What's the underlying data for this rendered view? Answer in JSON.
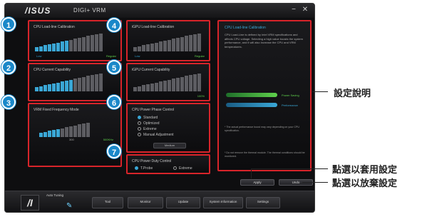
{
  "window": {
    "brand": "/ISUS",
    "title": "DIGI+ VRM",
    "minimize_glyph": "−",
    "close_glyph": "✕"
  },
  "panels": {
    "cpu_llc": {
      "title": "CPU Load-line Calibration",
      "low": "Low",
      "high": "Regular",
      "level": 8,
      "total": 16
    },
    "igpu_llc": {
      "title": "iGPU Load-line Calibration",
      "low": "Low",
      "high": "Regular",
      "level": 0,
      "total": 16
    },
    "cpu_current": {
      "title": "CPU Current Capability",
      "high": "100%",
      "level": 9,
      "total": 16
    },
    "igpu_current": {
      "title": "iGPU Current Capability",
      "high": "100%",
      "level": 0,
      "total": 16
    },
    "vrm_freq": {
      "title": "VRM Fixed Frequency Mode",
      "mid": "300",
      "high": "500KHz",
      "level": 5,
      "total": 12
    },
    "power_phase": {
      "title": "CPU Power Phase Control",
      "options": [
        "Standard",
        "Optimized",
        "Extreme",
        "Manual Adjustment"
      ],
      "selected": 0,
      "button": "Medium"
    },
    "power_duty": {
      "title": "CPU Power Duty Control",
      "options": [
        "T.Probe",
        "Extreme"
      ],
      "selected": 0
    }
  },
  "info": {
    "title": "CPU Load-line Calibration",
    "text": "CPU Load-Line is defined by Intel VRM specifications and affects CPU voltage. Selecting a high value boosts the system performance, and it will also increase the CPU and VRM temperatures.",
    "legend_1": "Power Saving",
    "legend_2": "Performance",
    "note_1": "* The actual performance boost may vary depending on your CPU specification.",
    "note_2": "* Do not remove the thermal module. The thermal conditions should be monitored."
  },
  "actions": {
    "apply": "Apply",
    "undo": "Undo"
  },
  "bottom": {
    "auto_tuning": "Auto Tuning",
    "tabs": [
      "Tool",
      "Monitor",
      "Update",
      "System Information",
      "Settings"
    ]
  },
  "badges": [
    "1",
    "2",
    "3",
    "4",
    "5",
    "6",
    "7"
  ],
  "callouts": {
    "description": "設定說明",
    "apply": "點選以套用設定",
    "undo": "點選以放棄設定"
  },
  "colors": {
    "accent": "#3aa7d6",
    "highlight": "#d8242a",
    "badge": "#1a88c9",
    "power_saving": "#4fc24a",
    "performance": "#3aa7d6"
  }
}
